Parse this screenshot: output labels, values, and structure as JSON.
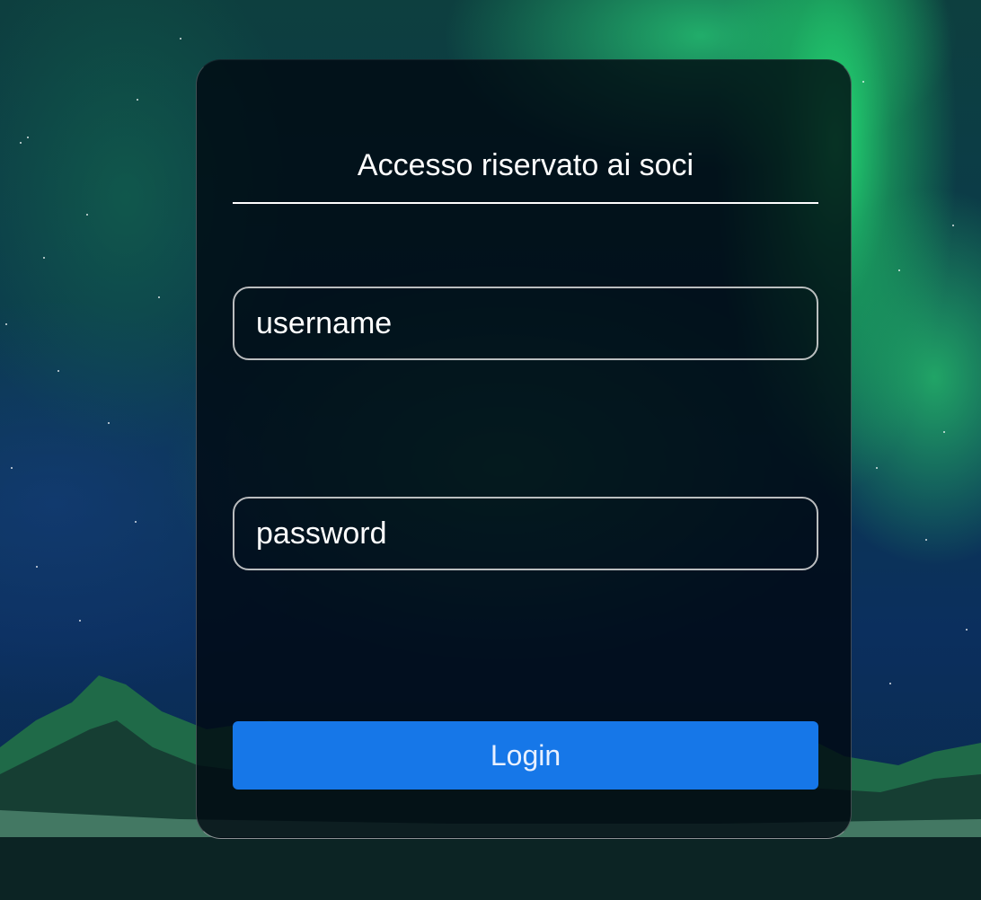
{
  "login": {
    "title": "Accesso riservato ai soci",
    "username_placeholder": "username",
    "password_placeholder": "password",
    "login_label": "Login"
  },
  "colors": {
    "button": "#1677e8",
    "aurora": "#26e678",
    "card": "#00080f"
  }
}
